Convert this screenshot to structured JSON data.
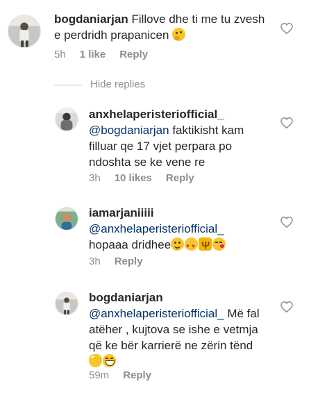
{
  "comments": [
    {
      "username": "bogdaniarjan",
      "text_line1": "Fillove dhe ti me tu zvesh",
      "text_line2": "e perdridh prapanicen",
      "time": "5h",
      "likes": "1 like",
      "reply": "Reply",
      "emoji": [
        "thinking-face-emoji"
      ]
    },
    {
      "username": "anxhelaperisteriofficial_",
      "mention": "@bogdaniarjan",
      "text_line1": "faktikisht kam",
      "text_line2": "filluar qe 17 vjet perpara po",
      "text_line3": "ndoshta se ke vene re",
      "time": "3h",
      "likes": "10 likes",
      "reply": "Reply"
    },
    {
      "username": "iamarjaniiiii",
      "mention": "@anxhelaperisteriofficial_",
      "text_line1": "hopaaa dridhee",
      "time": "3h",
      "reply": "Reply",
      "emoji": [
        "smiling-face-emoji",
        "heart-eyes-emoji",
        "trident-emoji",
        "kissing-face-emoji"
      ]
    },
    {
      "username": "bogdaniarjan",
      "mention": "@anxhelaperisteriofficial_",
      "text_line1": "Më fal",
      "text_line2": "atëher , kujtova se ishe e vetmja",
      "text_line3": "që ke bër karrierë ne zërin tënd",
      "time": "59m",
      "reply": "Reply",
      "emoji": [
        "clapping-hands-emoji",
        "grinning-face-emoji"
      ]
    }
  ],
  "hide_replies": "Hide replies",
  "colors": {
    "mention": "#003569",
    "meta": "#8e8e8e",
    "text": "#262626"
  }
}
